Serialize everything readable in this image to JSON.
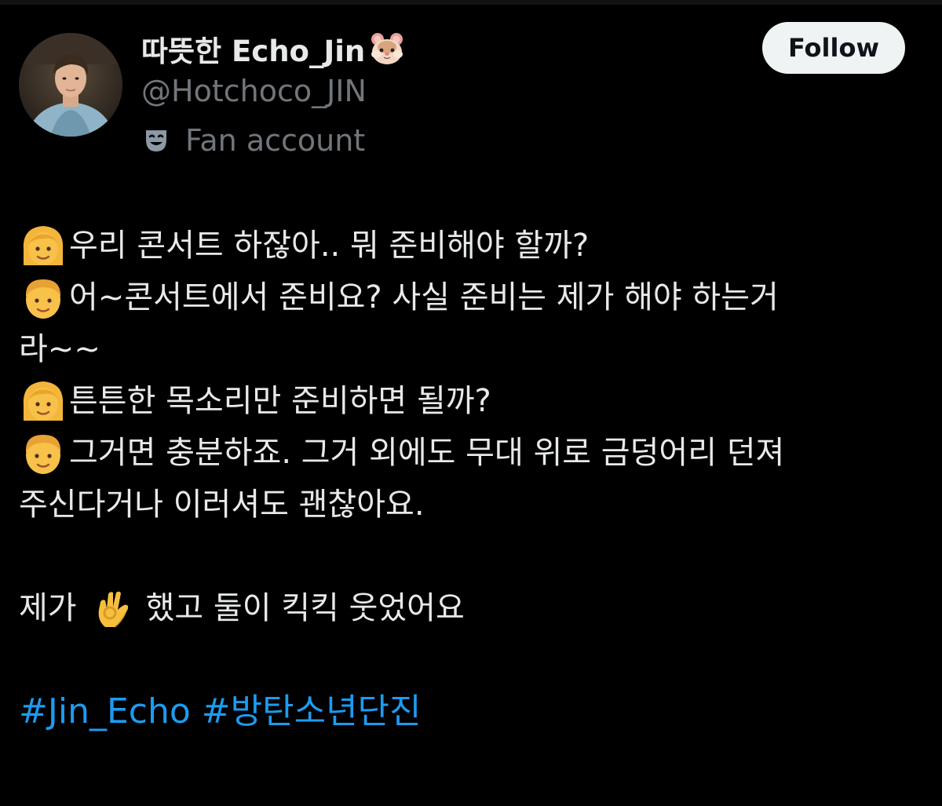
{
  "user": {
    "display_name": "따뜻한 Echo_Jin",
    "name_emoji": "hamster-face-icon",
    "handle": "@Hotchoco_JIN",
    "label_icon": "theater-mask-icon",
    "label_text": "Fan account"
  },
  "follow_button": {
    "label": "Follow"
  },
  "tweet": {
    "lines": [
      {
        "speaker_icon": "woman-face-icon",
        "text": "우리 콘서트 하잖아.. 뭐 준비해야 할까?"
      },
      {
        "speaker_icon": "man-face-icon",
        "text": "어~콘서트에서 준비요? 사실 준비는 제가  해야 하는거"
      },
      {
        "speaker_icon": "",
        "text": "라~~"
      },
      {
        "speaker_icon": "woman-face-icon",
        "text": "튼튼한 목소리만 준비하면 될까?"
      },
      {
        "speaker_icon": "man-face-icon",
        "text": "그거면 충분하죠. 그거 외에도 무대 위로 금덩어리 던져"
      },
      {
        "speaker_icon": "",
        "text": "주신다거나 이러셔도 괜찮아요."
      }
    ],
    "closing_prefix": "제가",
    "closing_icon": "ok-hand-icon",
    "closing_suffix": "했고 둘이 킥킥 웃었어요",
    "hashtags": [
      "#Jin_Echo",
      "#방탄소년단진"
    ]
  },
  "colors": {
    "background": "#000000",
    "text": "#e7e9ea",
    "secondary_text": "#71767b",
    "link": "#1d9bf0",
    "follow_bg": "#eff3f4"
  }
}
